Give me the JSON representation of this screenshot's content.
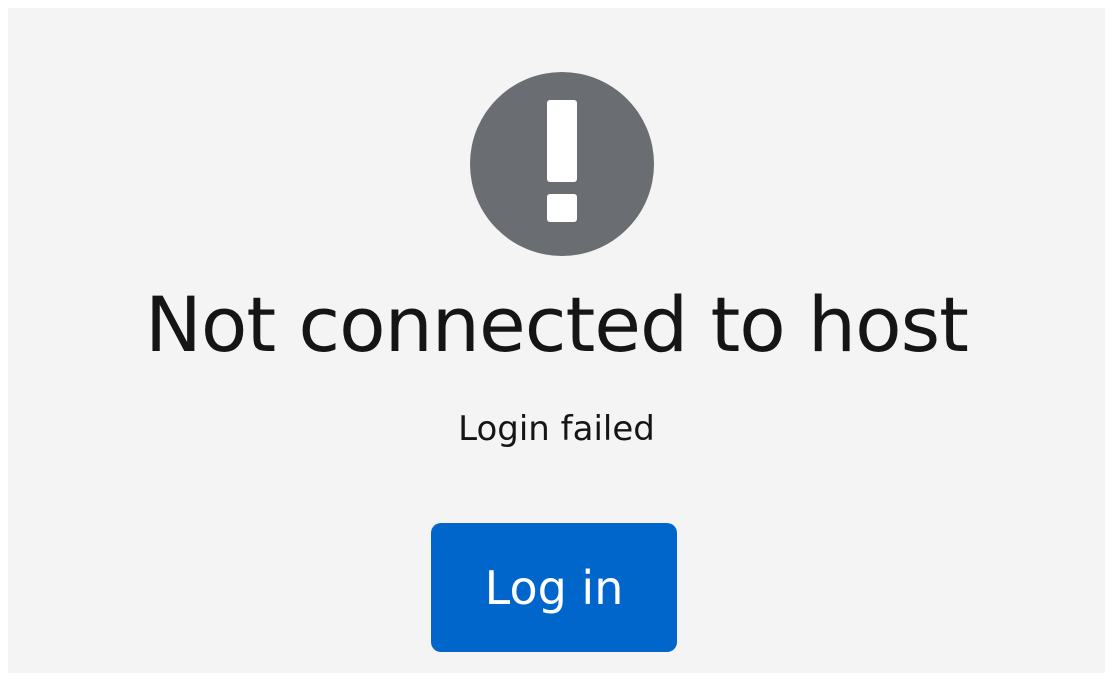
{
  "empty_state": {
    "icon": "exclamation-circle-icon",
    "icon_color": "#6a6e73",
    "title": "Not connected to host",
    "subtitle": "Login failed",
    "action_label": "Log in"
  },
  "colors": {
    "background": "#f4f4f4",
    "primary_button": "#0066cc",
    "text": "#151515"
  }
}
